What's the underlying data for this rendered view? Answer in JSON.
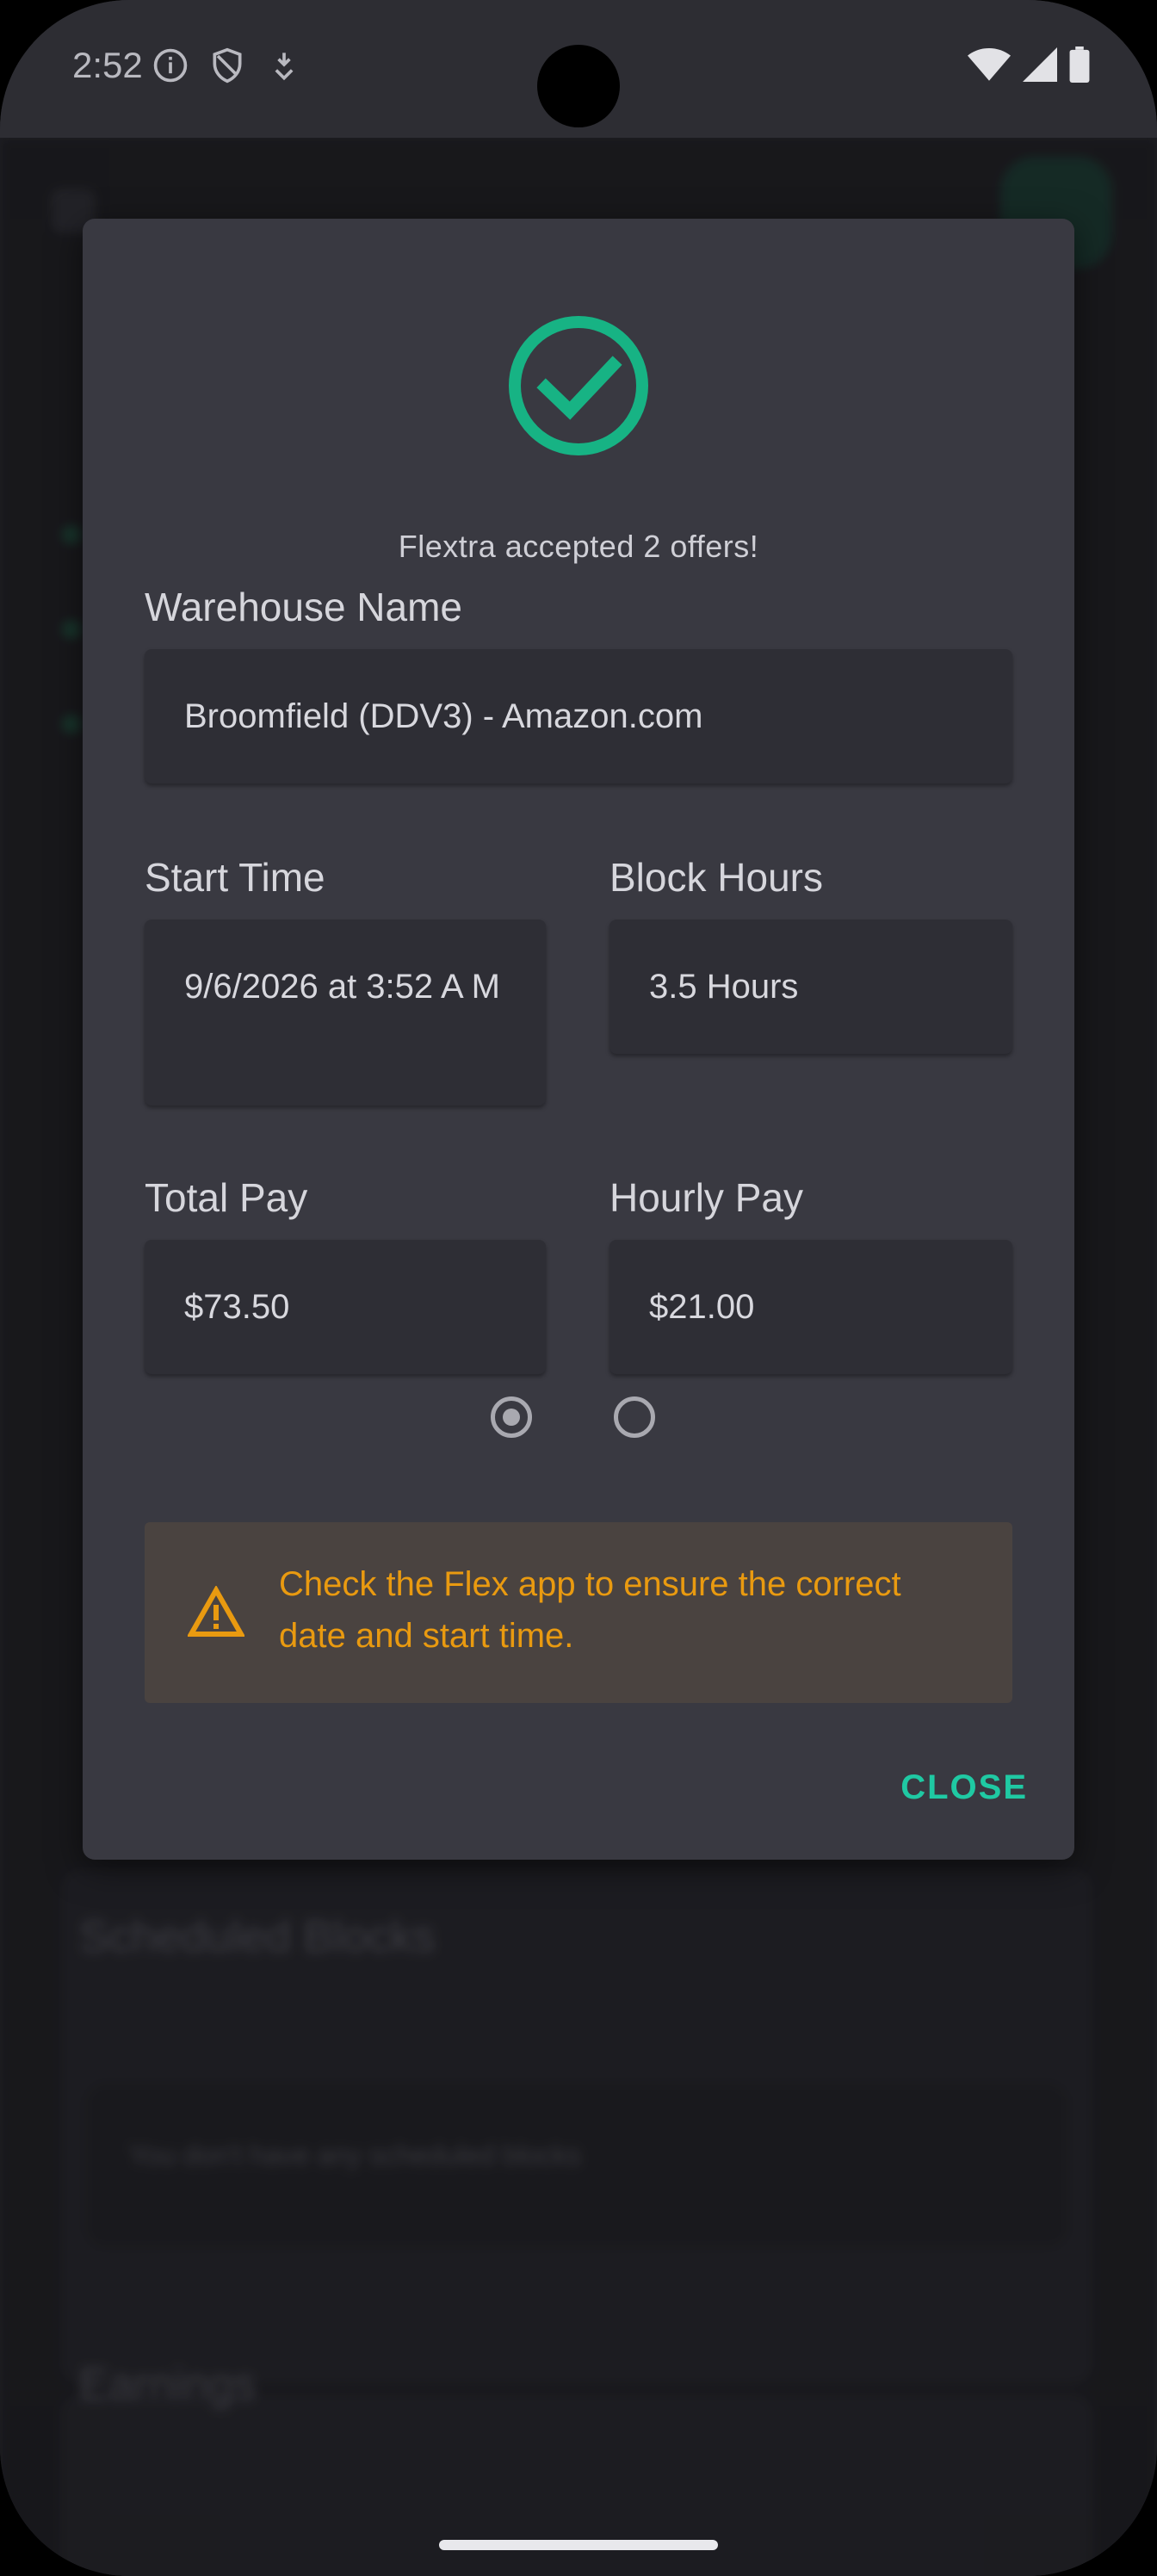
{
  "status_bar": {
    "time": "2:52"
  },
  "background": {
    "section_1_title": "Scheduled Blocks",
    "section_1_empty": "You don't have any scheduled blocks",
    "section_2_title": "Earnings"
  },
  "dialog": {
    "message": "Flextra accepted 2 offers!",
    "warehouse": {
      "label": "Warehouse Name",
      "value": "Broomfield (DDV3) - Amazon.com"
    },
    "start_time": {
      "label": "Start Time",
      "value": "9/6/2026 at 3:52 A M"
    },
    "block_hours": {
      "label": "Block Hours",
      "value": "3.5 Hours"
    },
    "total_pay": {
      "label": "Total Pay",
      "value": "$73.50"
    },
    "hourly_pay": {
      "label": "Hourly Pay",
      "value": "$21.00"
    },
    "page_indicator": {
      "count": 2,
      "selected": 0
    },
    "warning": {
      "text": "Check the Flex app to ensure the correct date and start time."
    },
    "close_label": "CLOSE"
  },
  "colors": {
    "accent": "#1fc9a3",
    "success_icon": "#17b384",
    "warning": "#e99a10",
    "dialog_bg": "#393941",
    "field_bg": "#2e2e35"
  },
  "icons": {
    "success": "check-circle-icon",
    "warning": "warning-triangle-icon"
  }
}
